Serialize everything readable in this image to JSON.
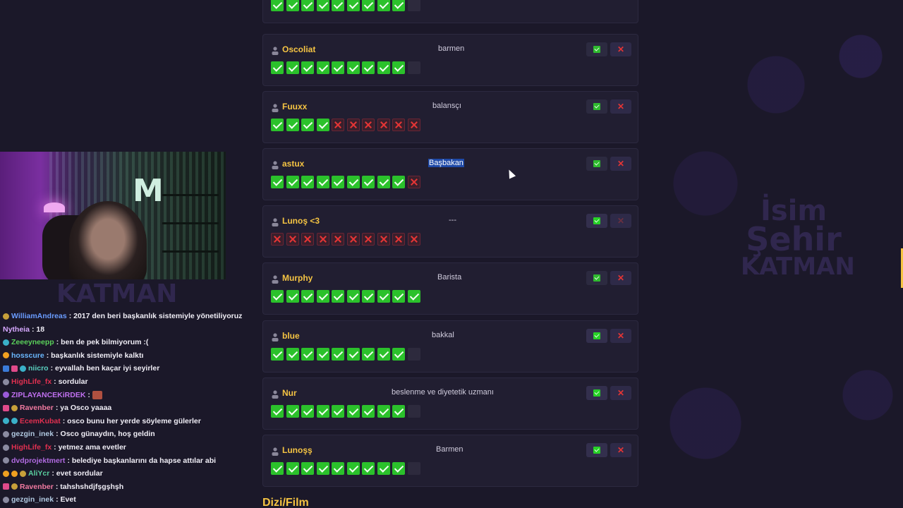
{
  "colors": {
    "accent": "#f5c443",
    "check": "#2bc12b",
    "cross": "#e53535",
    "background": "#1b1829",
    "card": "#211e31"
  },
  "icons": {
    "user": "user-icon",
    "approve": "check-icon",
    "reject": "close-icon"
  },
  "cards": [
    {
      "name": "",
      "job": "",
      "results": [
        "y",
        "y",
        "y",
        "y",
        "y",
        "y",
        "y",
        "y",
        "y",
        "e"
      ],
      "top_partial": true
    },
    {
      "name": "Oscoliat",
      "job": "barmen",
      "results": [
        "y",
        "y",
        "y",
        "y",
        "y",
        "y",
        "y",
        "y",
        "y",
        "e"
      ]
    },
    {
      "name": "Fuuxx",
      "job": "balansçı",
      "results": [
        "y",
        "y",
        "y",
        "y",
        "n",
        "n",
        "n",
        "n",
        "n",
        "n"
      ]
    },
    {
      "name": "astux",
      "job": "Başbakan",
      "job_selected": true,
      "results": [
        "y",
        "y",
        "y",
        "y",
        "y",
        "y",
        "y",
        "y",
        "y",
        "n"
      ]
    },
    {
      "name": "Lunoş <3",
      "job": "---",
      "results": [
        "n",
        "n",
        "n",
        "n",
        "n",
        "n",
        "n",
        "n",
        "n",
        "n"
      ],
      "approve_bright": true,
      "reject_dim": true
    },
    {
      "name": "Murphy",
      "job": "Barista",
      "results": [
        "y",
        "y",
        "y",
        "y",
        "y",
        "y",
        "y",
        "y",
        "y",
        "y"
      ]
    },
    {
      "name": "blue",
      "job": "bakkal",
      "results": [
        "y",
        "y",
        "y",
        "y",
        "y",
        "y",
        "y",
        "y",
        "y",
        "e"
      ],
      "approve_bright": true
    },
    {
      "name": "Nur",
      "job": "beslenme ve diyetetik uzmanı",
      "results": [
        "y",
        "y",
        "y",
        "y",
        "y",
        "y",
        "y",
        "y",
        "y",
        "e"
      ],
      "approve_bright": true
    },
    {
      "name": "Lunoşş",
      "job": "Barmen",
      "results": [
        "y",
        "y",
        "y",
        "y",
        "y",
        "y",
        "y",
        "y",
        "y",
        "e"
      ],
      "approve_bright": true
    }
  ],
  "next_section": "Dizi/Film",
  "watermark": {
    "line1": "İsim",
    "line2": "Şehir",
    "line3": "KATMAN"
  },
  "cam_watermark": "KATMAN",
  "chat": [
    {
      "badges": [
        "gold"
      ],
      "nick": "WilliamAndreas",
      "color": "#6a9cff",
      "text": ": 2017 den beri başkanlık sistemiyle yönetiliyoruz"
    },
    {
      "badges": [],
      "nick": "Nytheia",
      "color": "#d6a8ff",
      "text": ": 18"
    },
    {
      "badges": [
        "teal"
      ],
      "nick": "Zeeeyneepp",
      "color": "#5ad05a",
      "text": ": ben de pek bilmiyorum :("
    },
    {
      "badges": [
        "orange"
      ],
      "nick": "hosscure",
      "color": "#6ab8ff",
      "text": ": başkanlık sistemiyle kalktı"
    },
    {
      "badges": [
        "blue",
        "pink",
        "teal"
      ],
      "nick": "niicro",
      "color": "#5ad0c0",
      "text": ": eyvallah ben kaçar iyi seyirler"
    },
    {
      "badges": [
        "grey"
      ],
      "nick": "HighLife_fx",
      "color": "#e03050",
      "text": ": sordular"
    },
    {
      "badges": [
        "violet"
      ],
      "nick": "ZIPLAYANCEKiRDEK",
      "color": "#c070f0",
      "text": ":",
      "emote": true
    },
    {
      "badges": [
        "pink",
        "gold"
      ],
      "nick": "Ravenber",
      "color": "#f07aa0",
      "text": ": ya Osco yaaaa"
    },
    {
      "badges": [
        "teal",
        "teal"
      ],
      "nick": "EcemKubat",
      "color": "#e03050",
      "text": ": osco bunu her yerde söyleme gülerler"
    },
    {
      "badges": [
        "grey"
      ],
      "nick": "gezgin_inek",
      "color": "#b0c8e0",
      "text": ": Osco günaydın, hoş geldin"
    },
    {
      "badges": [
        "grey"
      ],
      "nick": "HighLife_fx",
      "color": "#e03050",
      "text": ": yetmez ama evetler"
    },
    {
      "badges": [
        "grey"
      ],
      "nick": "dvdprojektmert",
      "color": "#b06ae0",
      "text": ": belediye başkanlarını da hapse attılar abi"
    },
    {
      "badges": [
        "orange",
        "orange",
        "gold"
      ],
      "nick": "AliYcr",
      "color": "#5ad0a0",
      "text": ": evet sordular"
    },
    {
      "badges": [
        "pink",
        "gold"
      ],
      "nick": "Ravenber",
      "color": "#f07aa0",
      "text": ": tahshshdjfşgşhşh"
    },
    {
      "badges": [
        "grey"
      ],
      "nick": "gezgin_inek",
      "color": "#b0c8e0",
      "text": ": Evet"
    }
  ]
}
